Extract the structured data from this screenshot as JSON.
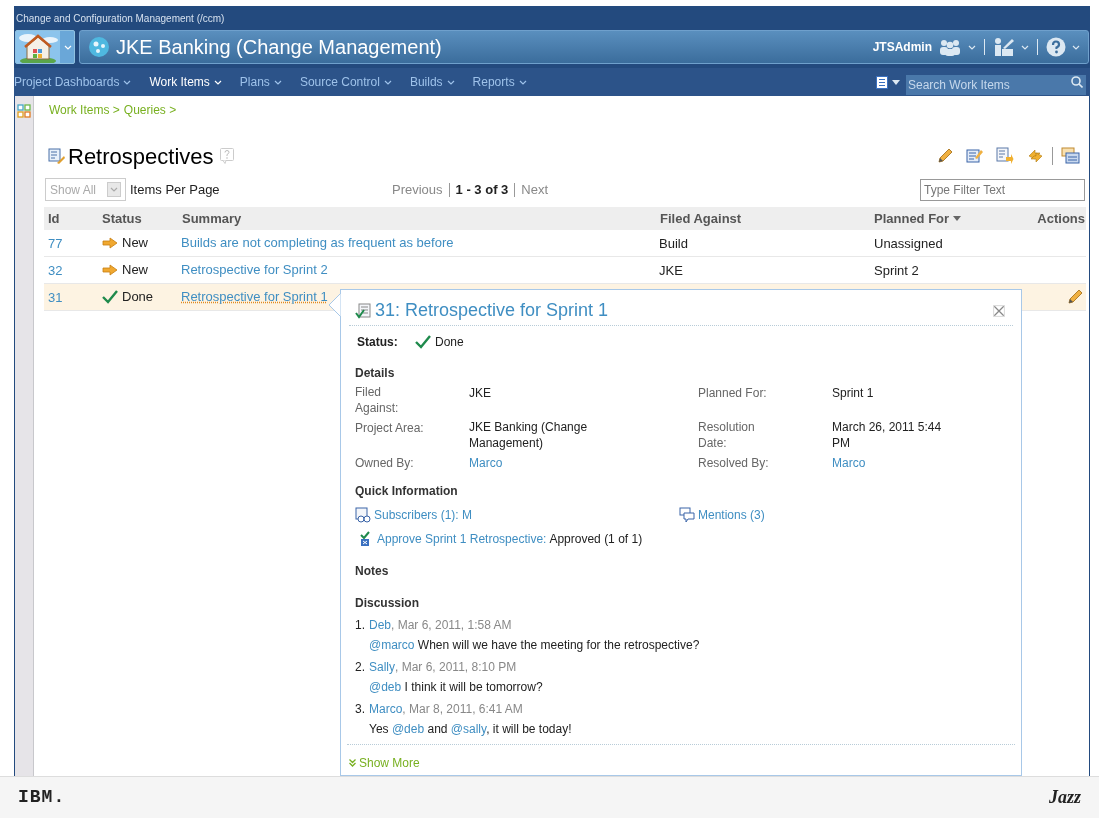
{
  "header": {
    "app_title": "Change and Configuration Management (/ccm)",
    "project": "JKE Banking (Change Management)",
    "user": "JTSAdmin"
  },
  "nav": [
    {
      "label": "Project Dashboards",
      "selected": false
    },
    {
      "label": "Work Items",
      "selected": true
    },
    {
      "label": "Plans",
      "selected": false
    },
    {
      "label": "Source Control",
      "selected": false
    },
    {
      "label": "Builds",
      "selected": false
    },
    {
      "label": "Reports",
      "selected": false
    }
  ],
  "search": {
    "placeholder": "Search Work Items"
  },
  "breadcrumb": [
    "Work Items >",
    "Queries >"
  ],
  "query": {
    "title": "Retrospectives"
  },
  "paging": {
    "page_size": "Show All",
    "page_size_label": "Items Per Page",
    "previous": "Previous",
    "range": "1 - 3 of 3",
    "next": "Next"
  },
  "filter": {
    "placeholder": "Type Filter Text"
  },
  "table": {
    "columns": [
      {
        "label": "Id",
        "sorted": false
      },
      {
        "label": "Status",
        "sorted": false
      },
      {
        "label": "Summary",
        "sorted": false
      },
      {
        "label": "Filed Against",
        "sorted": false
      },
      {
        "label": "Planned For",
        "sorted": true
      },
      {
        "label": "Actions",
        "sorted": false
      }
    ],
    "rows": [
      {
        "id": "77",
        "status": "New",
        "kind": "new",
        "summary": "Builds are not completing as frequent as before",
        "filed_against": "Build",
        "planned_for": "Unassigned",
        "selected": false
      },
      {
        "id": "32",
        "status": "New",
        "kind": "new",
        "summary": "Retrospective for Sprint 2",
        "filed_against": "JKE",
        "planned_for": "Sprint 2",
        "selected": false
      },
      {
        "id": "31",
        "status": "Done",
        "kind": "done",
        "summary": "Retrospective for Sprint 1",
        "selected": true
      }
    ]
  },
  "popover": {
    "title": "31: Retrospective for Sprint 1",
    "status_label": "Status:",
    "status": "Done",
    "kind": "done",
    "details_heading": "Details",
    "details": [
      {
        "label": "Filed Against:",
        "value": "JKE",
        "kind": "text"
      },
      {
        "label": "Planned For:",
        "value": "Sprint 1",
        "kind": "text"
      },
      {
        "label": "Project Area:",
        "value": "JKE Banking (Change Management)",
        "kind": "text"
      },
      {
        "label": "Resolution Date:",
        "value": "March 26, 2011 5:44 PM",
        "kind": "text"
      },
      {
        "label": "Owned By:",
        "value": "Marco",
        "kind": "link"
      },
      {
        "label": "Resolved By:",
        "value": "Marco",
        "kind": "link"
      }
    ],
    "quick_heading": "Quick Information",
    "quick": [
      {
        "kind": "subscribers",
        "text": "Subscribers (1): M"
      },
      {
        "kind": "mentions",
        "text": "Mentions (3)"
      },
      {
        "kind": "approval",
        "text": "Approve Sprint 1 Retrospective:",
        "status": "Approved (1 of 1)"
      }
    ],
    "notes_heading": "Notes",
    "discussion_heading": "Discussion",
    "comments": [
      {
        "number": "1.",
        "author": "Deb",
        "date": ", Mar 6, 2011, 1:58 AM",
        "parts": [
          {
            "kind": "mention",
            "text": "@marco"
          },
          {
            "kind": "text",
            "text": " When will we have the meeting for the retrospective?"
          }
        ]
      },
      {
        "number": "2.",
        "author": "Sally",
        "date": ", Mar 6, 2011, 8:10 PM",
        "parts": [
          {
            "kind": "mention",
            "text": "@deb"
          },
          {
            "kind": "text",
            "text": " I think it will be tomorrow?"
          }
        ]
      },
      {
        "number": "3.",
        "author": "Marco",
        "date": ", Mar 8, 2011, 6:41 AM",
        "parts": [
          {
            "kind": "text",
            "text": "Yes "
          },
          {
            "kind": "mention",
            "text": "@deb"
          },
          {
            "kind": "text",
            "text": " and "
          },
          {
            "kind": "mention",
            "text": "@sally"
          },
          {
            "kind": "text",
            "text": ", it will be today!"
          }
        ]
      }
    ],
    "show_more": "Show More"
  },
  "footer": {
    "left": "IBM.",
    "right": "Jazz"
  }
}
